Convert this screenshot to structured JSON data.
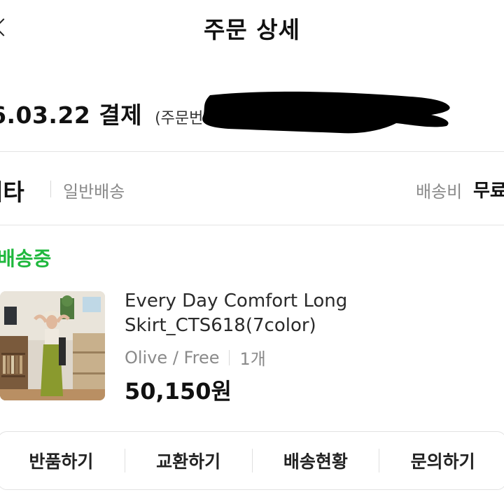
{
  "header": {
    "title": "주문 상세",
    "back_icon": "chevron-left-icon"
  },
  "order": {
    "date": "6.03.22 결제",
    "number_label": "(주문번호"
  },
  "seller": {
    "name": "씨타",
    "delivery_type": "일반배송",
    "fee_label": "배송비",
    "fee_value": "무료"
  },
  "shipment": {
    "status": "배송중",
    "status_color": "#1fb83d"
  },
  "product": {
    "name": "Every Day Comfort Long Skirt_CTS618(7color)",
    "option": "Olive / Free",
    "quantity": "1개",
    "price": "50,150원"
  },
  "actions": [
    {
      "label": "반품하기"
    },
    {
      "label": "교환하기"
    },
    {
      "label": "배송현황"
    },
    {
      "label": "문의하기"
    }
  ]
}
